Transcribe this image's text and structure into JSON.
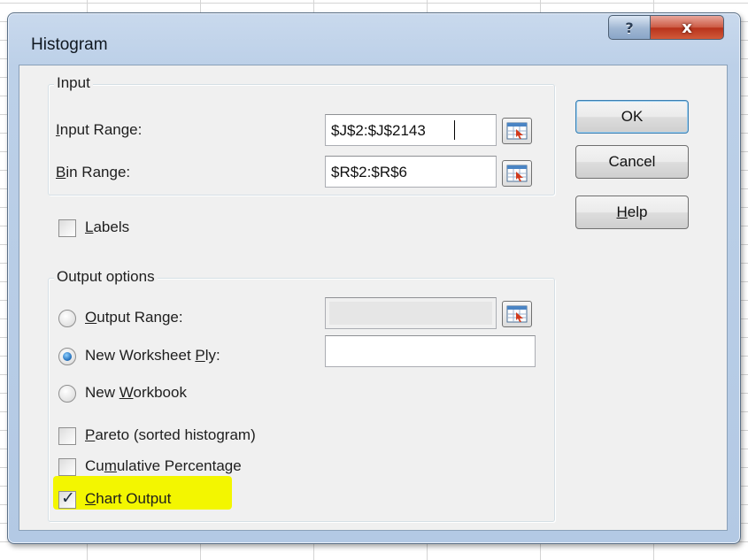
{
  "dialog": {
    "title": "Histogram",
    "help_glyph": "?",
    "close_glyph": "x"
  },
  "input_group": {
    "legend": "Input",
    "input_range": {
      "label_ul": "I",
      "label_rest": "nput Range:",
      "value": "$J$2:$J$2143"
    },
    "bin_range": {
      "label_ul": "B",
      "label_rest": "in Range:",
      "value": "$R$2:$R$6"
    },
    "labels": {
      "label_ul": "L",
      "label_rest": "abels",
      "checked": false
    }
  },
  "output_group": {
    "legend": "Output options",
    "output_range": {
      "label_ul": "O",
      "label_rest": "utput Range:",
      "selected": false,
      "value": ""
    },
    "new_worksheet_ply": {
      "label_pre": "New Worksheet ",
      "label_ul": "P",
      "label_rest": "ly:",
      "selected": true,
      "value": ""
    },
    "new_workbook": {
      "label_pre": "New ",
      "label_ul": "W",
      "label_rest": "orkbook",
      "selected": false
    },
    "pareto": {
      "label_ul": "P",
      "label_rest": "areto (sorted histogram)",
      "checked": false
    },
    "cumulative_percentage": {
      "label_pre": "Cu",
      "label_ul": "m",
      "label_rest": "ulative Percentage",
      "checked": false
    },
    "chart_output": {
      "label_ul": "C",
      "label_rest": "hart Output",
      "checked": true
    }
  },
  "buttons": {
    "ok": "OK",
    "cancel": "Cancel",
    "help_ul": "H",
    "help_rest": "elp"
  },
  "colors": {
    "highlight": "#f3f600",
    "close_button": "#c7432a",
    "default_button_border": "#3c7fb1"
  },
  "icons": {
    "range_selector": "collapse-dialog-icon",
    "check": "checkmark-icon"
  }
}
